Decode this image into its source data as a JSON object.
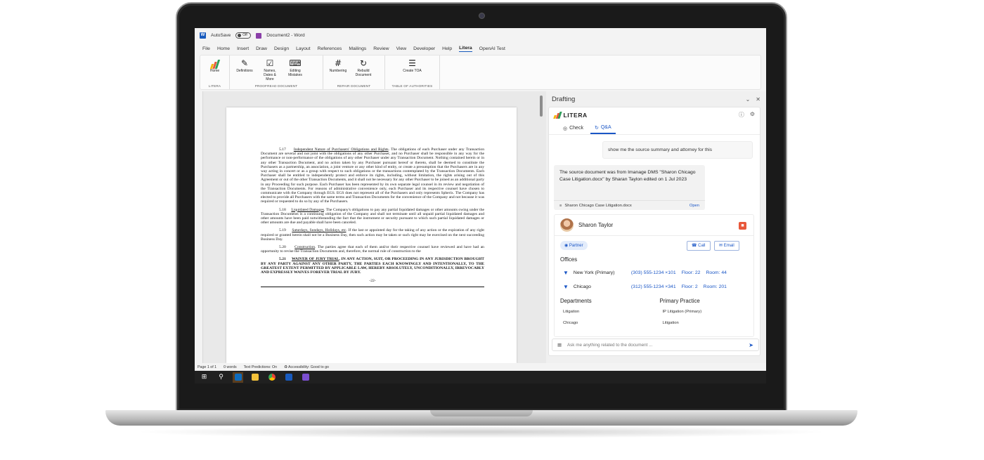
{
  "titlebar": {
    "autosave_label": "AutoSave",
    "autosave_state": "Off",
    "doc_title": "Document2 - Word"
  },
  "menu": [
    "File",
    "Home",
    "Insert",
    "Draw",
    "Design",
    "Layout",
    "References",
    "Mailings",
    "Review",
    "View",
    "Developer",
    "Help",
    "Litera",
    "OpenAI Test"
  ],
  "ribbon": {
    "groups": [
      {
        "label": "LITERA",
        "buttons": [
          {
            "label": "Home",
            "icon": "litera-logo-icon"
          }
        ]
      },
      {
        "label": "PROOFREAD DOCUMENT",
        "buttons": [
          {
            "label": "Definitions",
            "icon": "definitions-icon"
          },
          {
            "label": "Names, Dates & More",
            "icon": "calendar-check-icon"
          },
          {
            "label": "Editing Mistakes",
            "icon": "keyboard-icon"
          }
        ]
      },
      {
        "label": "REPAIR DOCUMENT",
        "buttons": [
          {
            "label": "Numbering",
            "icon": "hash-icon"
          },
          {
            "label": "Rebuild Document",
            "icon": "refresh-icon"
          }
        ]
      },
      {
        "label": "TABLE OF AUTHORITIES",
        "buttons": [
          {
            "label": "Create TOA",
            "icon": "list-icon"
          }
        ]
      }
    ]
  },
  "document": {
    "p1_num": "5.17",
    "p1_title": "Independent Nature of Purchasers' Obligations and Rights",
    "p1_body": ". The obligations of each Purchaser under any Transaction Document are several and not joint with the obligations of any other Purchaser, and no Purchaser shall be responsible in any way for the performance or non-performance of the obligations of any other Purchaser under any Transaction Document. Nothing contained herein or in any other Transaction Document, and no action taken by any Purchaser pursuant hereof or thereto, shall be deemed to constitute the Purchasers as a partnership, an association, a joint venture or any other kind of entity, or create a presumption that the Purchasers are in any way acting in concert or as a group with respect to such obligations or the transactions contemplated by the Transaction Documents. Each Purchaser shall be entitled to independently protect and enforce its rights, including, without limitation, the rights arising out of this Agreement or out of the other Transaction Documents, and it shall not be necessary for any other Purchaser to be joined as an additional party in any Proceeding for such purpose. Each Purchaser has been represented by its own separate legal counsel in its review and negotiation of the Transaction Documents. For reasons of administrative convenience only, each Purchaser and its respective counsel have chosen to communicate with the Company through EGS. EGS does not represent all of the Purchasers and only represents Spherix. The Company has elected to provide all Purchasers with the same terms and Transaction Documents for the convenience of the Company and not because it was required or requested to do so by any of the Purchasers.",
    "p2_num": "5.18",
    "p2_title": "Liquidated Damages",
    "p2_body": ". The Company's obligations to pay any partial liquidated damages or other amounts owing under the Transaction Documents is a continuing obligation of the Company and shall not terminate until all unpaid partial liquidated damages and other amounts have been paid notwithstanding the fact that the instrument or security pursuant to which such partial liquidated damages or other amounts are due and payable shall have been canceled.",
    "p3_num": "5.19",
    "p3_title": "Saturdays, Sundays, Holidays, etc",
    "p3_body": ". If the last or appointed day for the taking of any action or the expiration of any right required or granted herein shall not be a Business Day, then such action may be taken or such right may be exercised on the next succeeding Business Day.",
    "p4_num": "5.20",
    "p4_title": "Construction",
    "p4_body": ". The parties agree that each of them and/or their respective counsel have reviewed and have had an opportunity to revise the Transaction Documents and, therefore, the normal rule of construction to the",
    "p5_num": "5.21",
    "p5_title": "WAIVER OF JURY TRIAL",
    "p5_body": ". IN ANY ACTION, SUIT, OR PROCEEDING IN ANY JURISDICTION BROUGHT BY ANY PARTY AGAINST ANY OTHER PARTY, THE PARTIES EACH KNOWINGLY AND INTENTIONALLY, TO THE GREATEST EXTENT PERMITTED BY APPLICABLE LAW, HEREBY ABSOLUTELY, UNCONDITIONALLY, IRREVOCABLY AND EXPRESSLY WAIVES FOREVER TRIAL BY JURY.",
    "page_number": "-22-"
  },
  "pane": {
    "title": "Drafting",
    "brand": "LITERA",
    "tabs": [
      "Check",
      "Q&A"
    ],
    "user_message": "show me the source summary and attorney for this",
    "ai_message": "The source document was from Imanage DMS \"Sharon Chicago Case Litigation.docx\" by Sharan Taylon edited on 1 Jul 2023",
    "file_name": "Sharon Chicago Case Litigation.docx",
    "file_action": "Open",
    "contact": {
      "name": "Sharon Taylor",
      "role": "Partner",
      "call_label": "Call",
      "email_label": "Email",
      "offices_title": "Offices",
      "offices": [
        {
          "name": "New York (Primary)",
          "phone": "(303) 555-1234 ×101",
          "floor": "Floor: 22",
          "room": "Room: 44"
        },
        {
          "name": "Chicago",
          "phone": "(312) 555-1234 ×341",
          "floor": "Floor: 2",
          "room": "Room: 201"
        }
      ],
      "departments_title": "Departments",
      "departments": [
        "Litigation",
        "Chicago"
      ],
      "practice_title": "Primary Practice",
      "practices": [
        "IP Litigation (Primary)",
        "Litigation"
      ]
    },
    "ask_placeholder": "Ask me anything related to the document ..."
  },
  "status": {
    "page": "Page 1 of 1",
    "words": "0 words",
    "predictions": "Text Predictions: On",
    "accessibility": "Accessibility: Good to go"
  },
  "colors": {
    "accent": "#1a56c6",
    "word_blue": "#185abd",
    "litera_red": "#e8583b"
  }
}
